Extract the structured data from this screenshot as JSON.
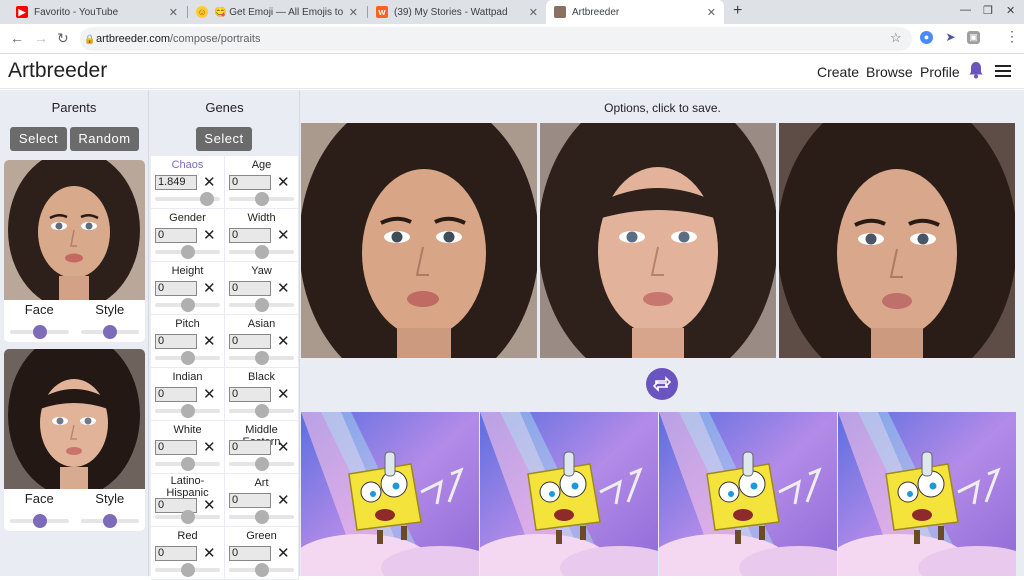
{
  "browser": {
    "tabs": [
      {
        "title": "Favorito - YouTube",
        "favicon": "youtube-icon"
      },
      {
        "title": "😋 Get Emoji — All Emojis to ✂️ Copy and Paste 👌",
        "favicon": "emoji-icon"
      },
      {
        "title": "(39) My Stories - Wattpad",
        "favicon": "wattpad-icon"
      },
      {
        "title": "Artbreeder",
        "favicon": "artbreeder-icon"
      }
    ],
    "url_host": "artbreeder.com",
    "url_path": "/compose/portraits"
  },
  "site": {
    "logo": "Artbreeder",
    "nav": [
      "Create",
      "Browse",
      "Profile"
    ],
    "accent": "#6a55c0"
  },
  "parents": {
    "title": "Parents",
    "select_label": "Select",
    "random_label": "Random",
    "cards": [
      {
        "face_label": "Face",
        "style_label": "Style",
        "face_level": 0.5,
        "style_level": 0.5
      },
      {
        "face_label": "Face",
        "style_label": "Style",
        "face_level": 0.5,
        "style_level": 0.5
      }
    ]
  },
  "genes": {
    "title": "Genes",
    "select_label": "Select",
    "items": [
      {
        "name": "Chaos",
        "value": "1.849",
        "level": 0.82
      },
      {
        "name": "Age",
        "value": "0",
        "level": 0.5
      },
      {
        "name": "Gender",
        "value": "0",
        "level": 0.5
      },
      {
        "name": "Width",
        "value": "0",
        "level": 0.5
      },
      {
        "name": "Height",
        "value": "0",
        "level": 0.5
      },
      {
        "name": "Yaw",
        "value": "0",
        "level": 0.5
      },
      {
        "name": "Pitch",
        "value": "0",
        "level": 0.5
      },
      {
        "name": "Asian",
        "value": "0",
        "level": 0.5
      },
      {
        "name": "Indian",
        "value": "0",
        "level": 0.5
      },
      {
        "name": "Black",
        "value": "0",
        "level": 0.5
      },
      {
        "name": "White",
        "value": "0",
        "level": 0.5
      },
      {
        "name": "Middle Eastern",
        "value": "0",
        "level": 0.5
      },
      {
        "name": "Latino-Hispanic",
        "value": "0",
        "level": 0.5
      },
      {
        "name": "Art",
        "value": "0",
        "level": 0.5
      },
      {
        "name": "Red",
        "value": "0",
        "level": 0.5
      },
      {
        "name": "Green",
        "value": "0",
        "level": 0.5
      }
    ]
  },
  "options": {
    "title": "Options, click to save.",
    "count": 3
  }
}
